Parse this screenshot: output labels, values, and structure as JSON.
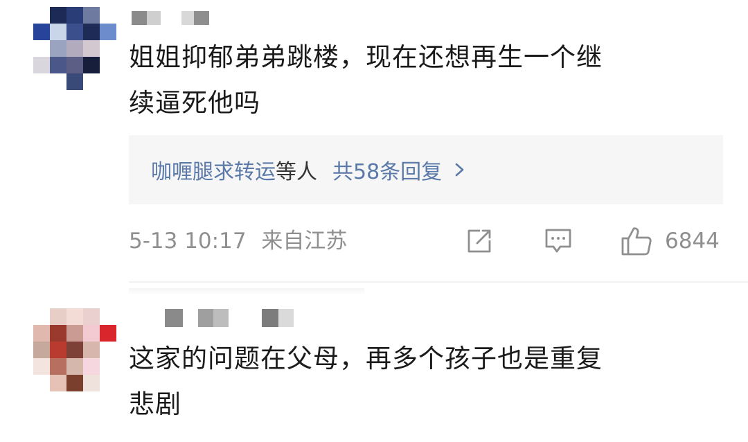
{
  "comments": [
    {
      "text_line1": "姐姐抑郁弟弟跳楼，现在还想再生一个继",
      "text_line2": "续逼死他吗",
      "replies": {
        "names": "咖喱腿求转运",
        "suffix": "等人",
        "count": "共58条回复"
      },
      "time": "5-13 10:17",
      "location": "来自江苏",
      "likes": "6844"
    },
    {
      "text_line1": "这家的问题在父母，再多个孩子也是重复",
      "text_line2": "悲剧"
    }
  ],
  "icons": {
    "share": "share-icon",
    "comment": "comment-icon",
    "like": "thumbs-up-icon",
    "chevron": "chevron-right-icon"
  },
  "colors": {
    "link_blue": "#5a79a8",
    "meta_gray": "#8f8f8f",
    "text": "#1a1a1a",
    "reply_bg": "#f6f6f6"
  }
}
